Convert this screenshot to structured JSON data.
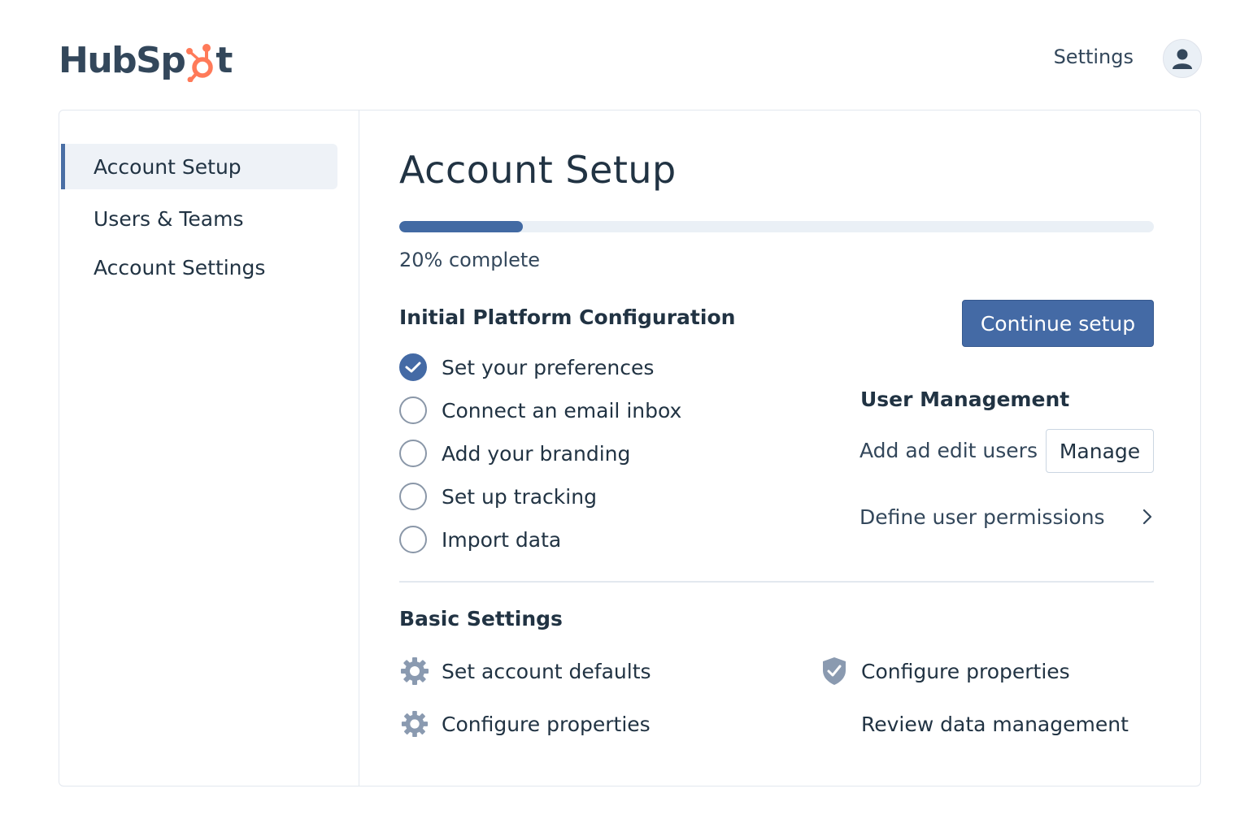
{
  "header": {
    "logo_text_left": "HubSp",
    "logo_text_right": "t",
    "settings_label": "Settings",
    "avatar_icon": "user-icon"
  },
  "sidebar": {
    "items": [
      {
        "label": "Account Setup",
        "active": true
      },
      {
        "label": "Users & Teams",
        "active": false
      },
      {
        "label": "Account Settings",
        "active": false
      }
    ]
  },
  "main": {
    "title": "Account Setup",
    "progress": {
      "percent": 20,
      "label": "20% complete"
    },
    "initial_config": {
      "title": "Initial Platform Configuration",
      "tasks": [
        {
          "label": "Set your preferences",
          "done": true
        },
        {
          "label": "Connect an email inbox",
          "done": false
        },
        {
          "label": "Add your branding",
          "done": false
        },
        {
          "label": "Set up tracking",
          "done": false
        },
        {
          "label": "Import data",
          "done": false
        }
      ]
    },
    "continue_label": "Continue setup",
    "user_management": {
      "title": "User Management",
      "add_users_text": "Add ad edit users",
      "manage_label": "Manage",
      "permissions_label": "Define user permissions",
      "chevron_icon": "chevron-right-icon"
    },
    "basic_settings": {
      "title": "Basic Settings",
      "items_left": [
        {
          "label": "Set account defaults",
          "icon": "gear-icon"
        },
        {
          "label": "Configure properties",
          "icon": "gear-icon"
        }
      ],
      "items_right": [
        {
          "label": "Configure properties",
          "icon": "shield-check-icon"
        },
        {
          "label": "Review data management",
          "icon": ""
        }
      ]
    }
  },
  "colors": {
    "accent": "#446aa5",
    "logo_orange": "#ff7a59",
    "text": "#213343"
  }
}
